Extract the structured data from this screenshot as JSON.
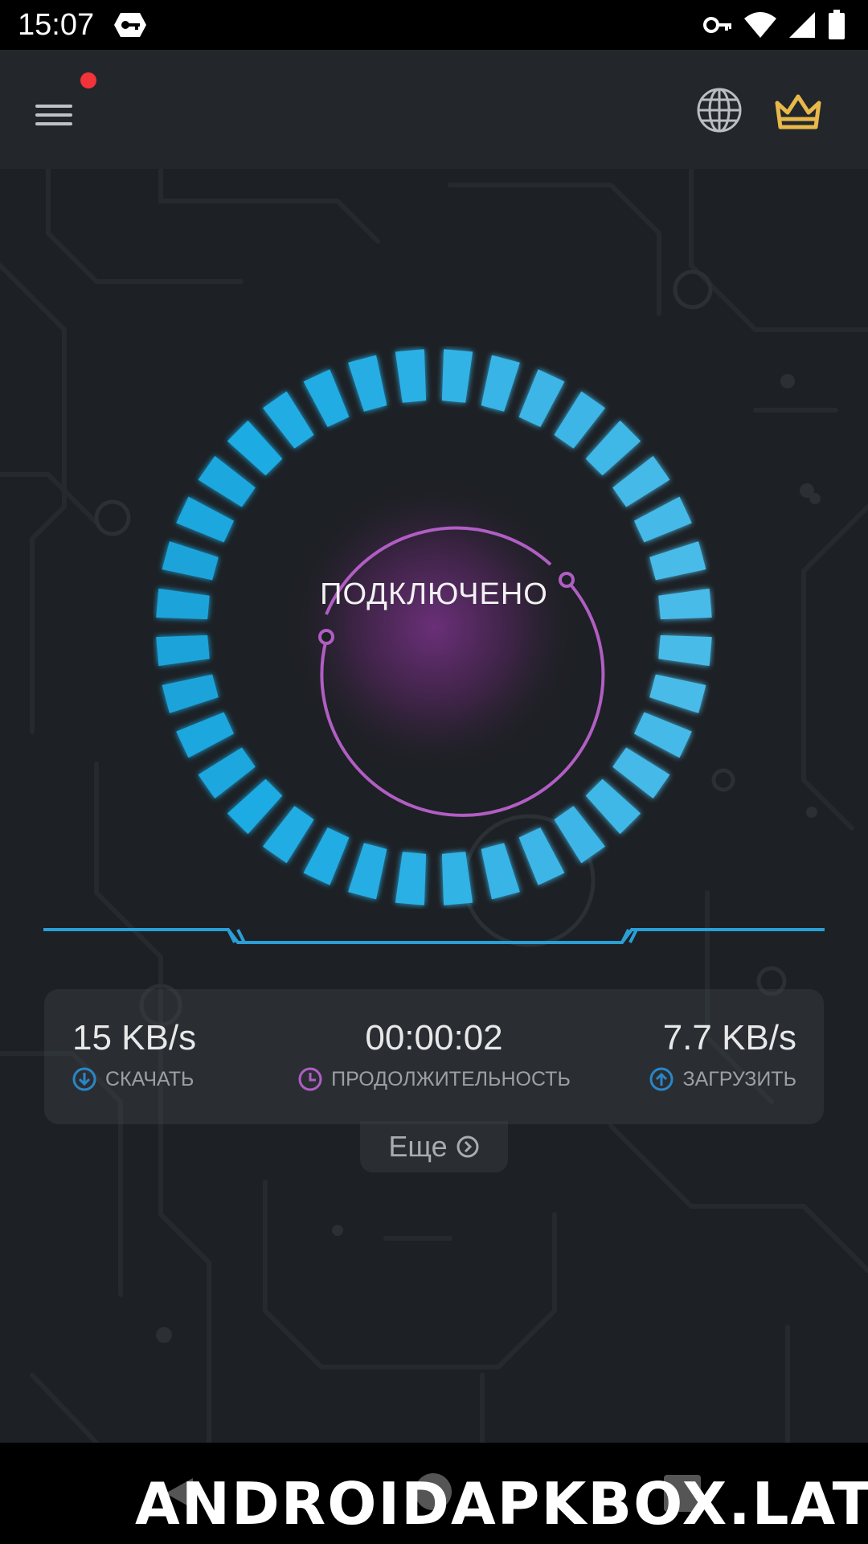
{
  "status_bar": {
    "time": "15:07",
    "icons": [
      "vpn-key-icon",
      "wifi-icon",
      "signal-icon",
      "battery-icon"
    ]
  },
  "app_bar": {
    "icons": [
      "menu-icon",
      "globe-icon",
      "crown-icon"
    ],
    "notification_dot_color": "#f2333a",
    "crown_color": "#e8b84a"
  },
  "connection": {
    "status": "ПОДКЛЮЧЕНО",
    "ring_color": "#3cc2ee",
    "inner_color": "#b15ec4"
  },
  "stats": {
    "download": {
      "value": "15 KB/s",
      "label": "СКАЧАТЬ",
      "icon": "download-arrow-icon",
      "icon_color": "#2a86c7"
    },
    "duration": {
      "value": "00:00:02",
      "label": "ПРОДОЛЖИТЕЛЬНОСТЬ",
      "icon": "clock-icon",
      "icon_color": "#b15ec4"
    },
    "upload": {
      "value": "7.7 KB/s",
      "label": "ЗАГРУЗИТЬ",
      "icon": "upload-arrow-icon",
      "icon_color": "#2a86c7"
    }
  },
  "more": {
    "label": "Еще",
    "icon": "chevron-circle-right-icon"
  },
  "nav_bar": {
    "icons": [
      "back-icon",
      "home-icon",
      "recents-icon"
    ]
  },
  "watermark": "ANDROIDAPKBOX.LAT"
}
